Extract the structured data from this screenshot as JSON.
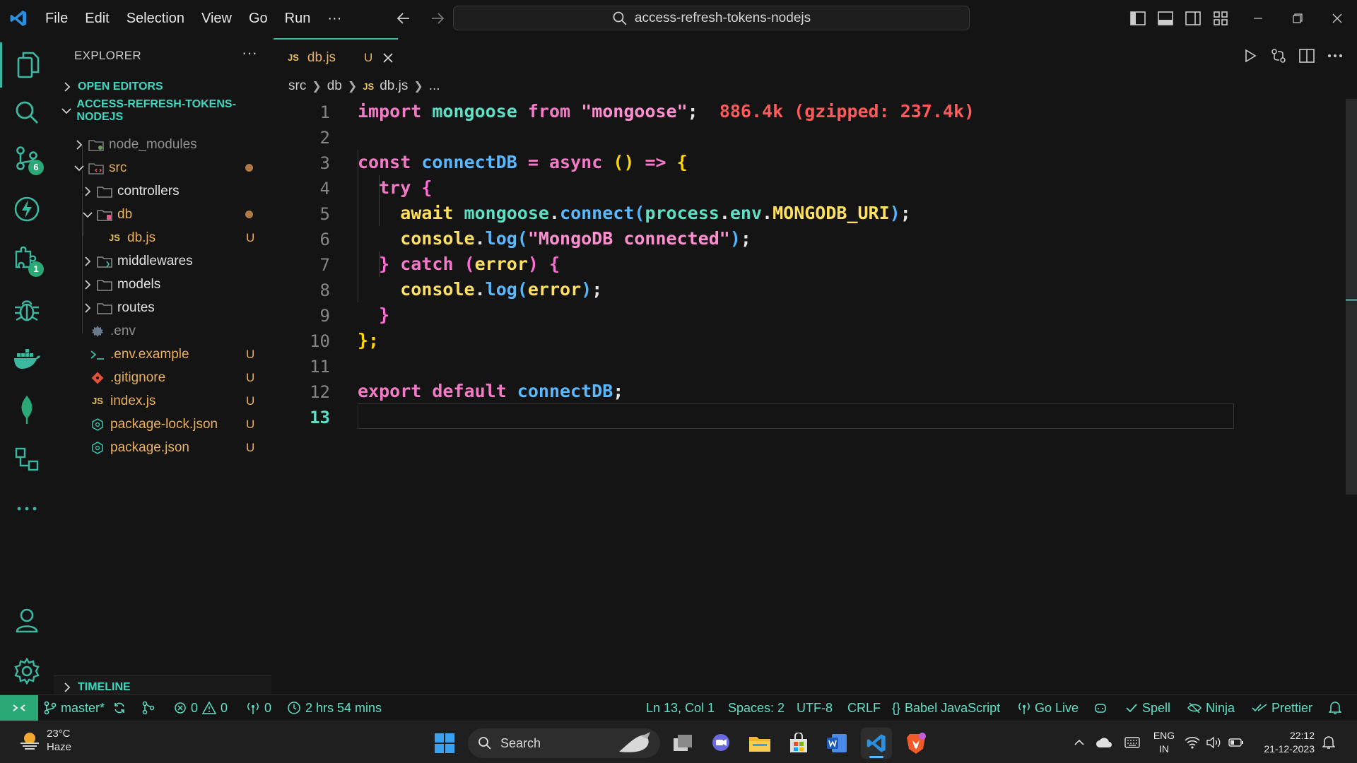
{
  "titlebar": {
    "menu": [
      "File",
      "Edit",
      "Selection",
      "View",
      "Go",
      "Run",
      "···"
    ],
    "command_center": "access-refresh-tokens-nodejs"
  },
  "activity_badges": {
    "source_control": "6",
    "extensions": "1"
  },
  "explorer": {
    "title": "EXPLORER",
    "more": "···",
    "open_editors": "OPEN EDITORS",
    "project": "ACCESS-REFRESH-TOKENS-NODEJS",
    "items": [
      {
        "label": "node_modules",
        "status": ""
      },
      {
        "label": "src",
        "status": "dot"
      },
      {
        "label": "controllers",
        "status": ""
      },
      {
        "label": "db",
        "status": "dot"
      },
      {
        "label": "db.js",
        "status": "U"
      },
      {
        "label": "middlewares",
        "status": ""
      },
      {
        "label": "models",
        "status": ""
      },
      {
        "label": "routes",
        "status": ""
      },
      {
        "label": ".env",
        "status": ""
      },
      {
        "label": ".env.example",
        "status": "U"
      },
      {
        "label": ".gitignore",
        "status": "U"
      },
      {
        "label": "index.js",
        "status": "U"
      },
      {
        "label": "package-lock.json",
        "status": "U"
      },
      {
        "label": "package.json",
        "status": "U"
      }
    ],
    "timeline": "TIMELINE"
  },
  "tab": {
    "icon": "JS",
    "name": "db.js",
    "status": "U"
  },
  "breadcrumb": {
    "parts": [
      "src",
      "db",
      "db.js",
      "..."
    ],
    "icon": "JS"
  },
  "editor": {
    "line_numbers": [
      "1",
      "2",
      "3",
      "4",
      "5",
      "6",
      "7",
      "8",
      "9",
      "10",
      "11",
      "12",
      "13"
    ],
    "import_cost": "886.4k (gzipped: 237.4k)",
    "tokens": {
      "import": "import",
      "mongoose": "mongoose",
      "from": "from",
      "mod_str": "\"mongoose\"",
      "semi": ";",
      "const": "const",
      "connectDB": "connectDB",
      "eq": "=",
      "async": "async",
      "paren_pair": "()",
      "arrow": "=>",
      "lbrace": "{",
      "try": "try",
      "await": "await",
      "dot": ".",
      "connect": "connect",
      "lparen": "(",
      "process": "process",
      "env": "env",
      "mongodb_uri": "MONGODB_URI",
      "rparen": ")",
      "console": "console",
      "log": "log",
      "connected_str": "\"MongoDB connected\"",
      "rbrace": "}",
      "catch": "catch",
      "error": "error",
      "close": "};",
      "export": "export",
      "default": "default"
    }
  },
  "status": {
    "branch": "master*",
    "errors": "0",
    "warnings": "0",
    "ports": "0",
    "time": "2 hrs 54 mins",
    "position": "Ln 13, Col 1",
    "spaces": "Spaces: 2",
    "encoding": "UTF-8",
    "eol": "CRLF",
    "language": "Babel JavaScript",
    "golive": "Go Live",
    "spell": "Spell",
    "ninja": "Ninja",
    "prettier": "Prettier"
  },
  "taskbar": {
    "temp": "23°C",
    "weather": "Haze",
    "search": "Search",
    "lang1": "ENG",
    "lang2": "IN",
    "time": "22:12",
    "date": "21-12-2023"
  },
  "colors": {
    "accent": "#3db8a0",
    "modified": "#e8b05c",
    "remote": "#2aa876"
  }
}
